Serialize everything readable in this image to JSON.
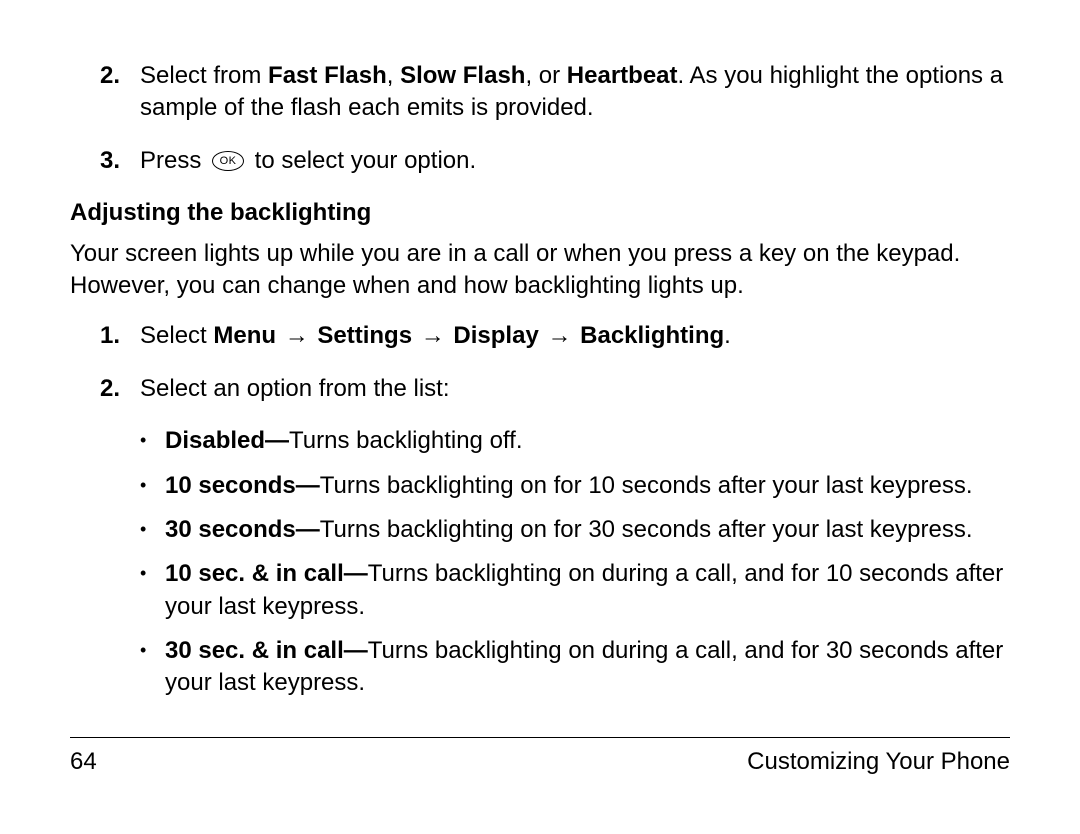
{
  "items": {
    "n2_num": "2.",
    "n2_a": "Select from ",
    "n2_b1": "Fast Flash",
    "n2_c1": ", ",
    "n2_b2": "Slow Flash",
    "n2_c2": ", or ",
    "n2_b3": "Heartbeat",
    "n2_d": ". As you highlight the options a sample of the flash each emits is provided.",
    "n3_num": "3.",
    "n3_a": "Press ",
    "n3_ok": "OK",
    "n3_b": " to select your option."
  },
  "heading": "Adjusting the backlighting",
  "para": "Your screen lights up while you are in a call or when you press a key on the keypad. However, you can change when and how backlighting lights up.",
  "list2": {
    "n1_num": "1.",
    "n1_a": "Select ",
    "n1_b1": "Menu",
    "n1_b2": "Settings",
    "n1_b3": "Display",
    "n1_b4": "Backlighting",
    "n1_arrow": " → ",
    "n1_end": ".",
    "n2_num": "2.",
    "n2_text": "Select an option from the list:"
  },
  "bullets": {
    "b1_k": "Disabled—",
    "b1_v": "Turns backlighting off.",
    "b2_k": "10 seconds—",
    "b2_v": "Turns backlighting on for 10 seconds after your last keypress.",
    "b3_k": "30 seconds—",
    "b3_v": "Turns backlighting on for 30 seconds after your last keypress.",
    "b4_k": "10 sec. & in call—",
    "b4_v": "Turns backlighting on during a call, and for 10 seconds after your last keypress.",
    "b5_k": "30 sec. & in call—",
    "b5_v": "Turns backlighting on during a call, and for 30 seconds after your last keypress."
  },
  "footer": {
    "page": "64",
    "section": "Customizing Your Phone"
  }
}
